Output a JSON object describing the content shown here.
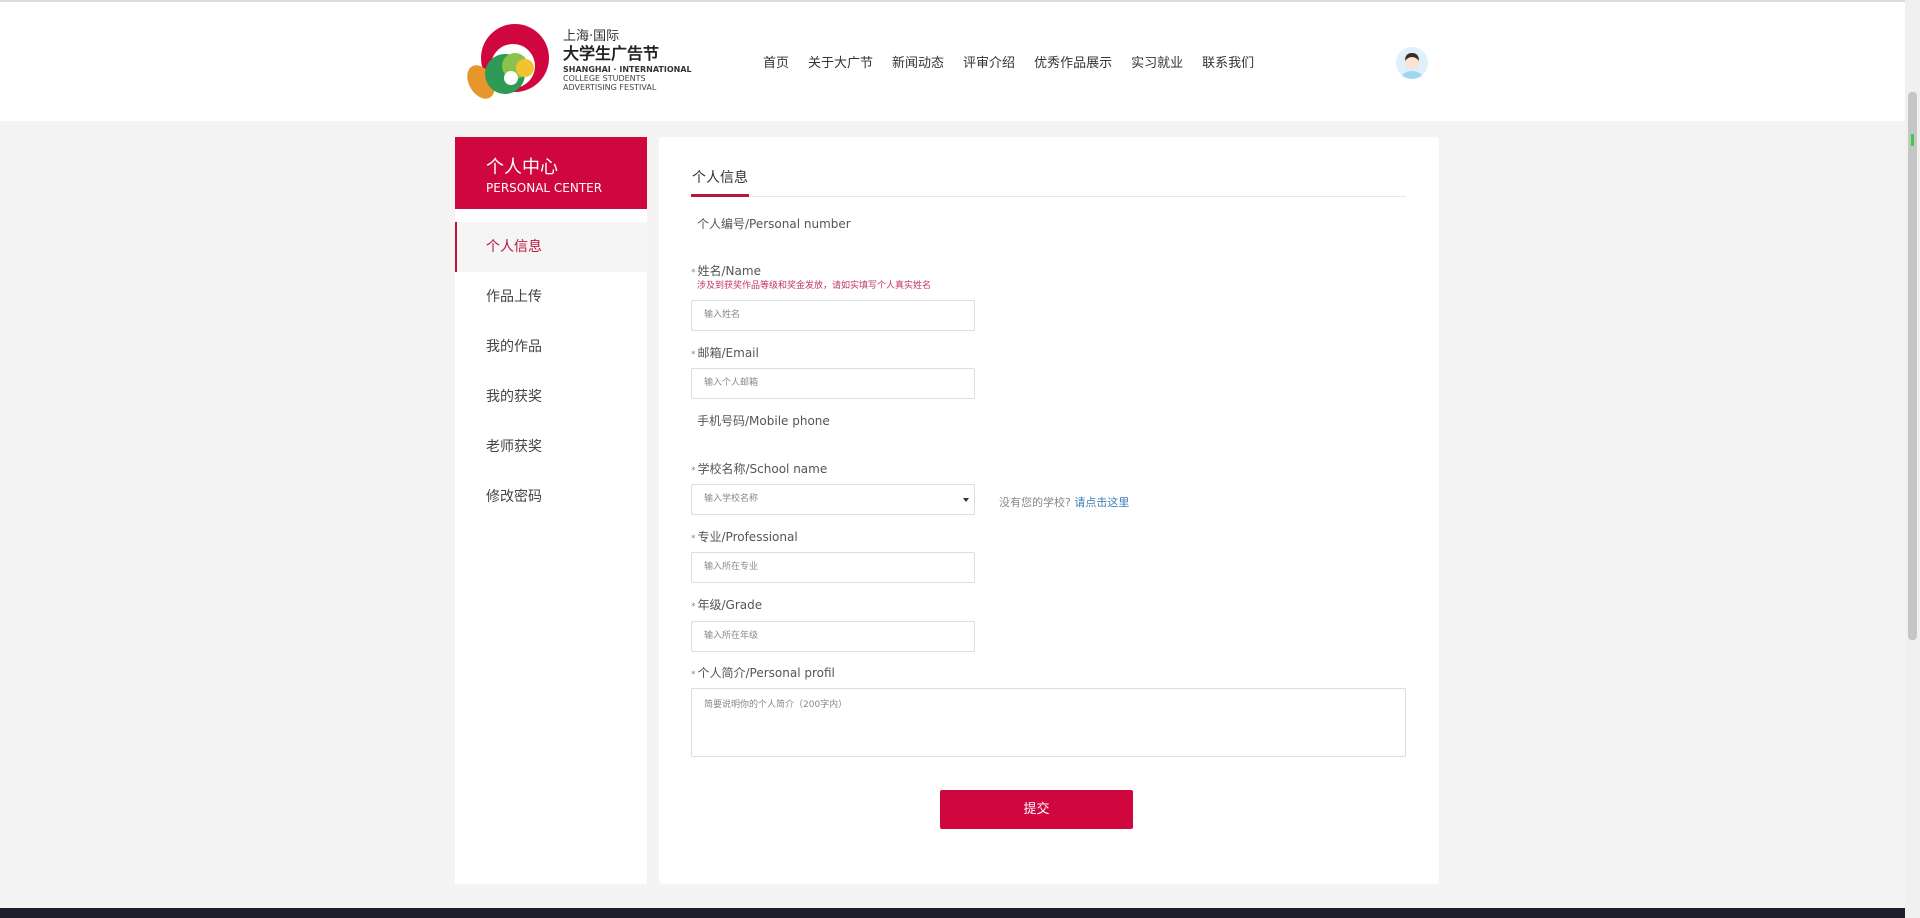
{
  "logo": {
    "line1": "上海·国际",
    "line2": "大学生广告节",
    "line3": "SHANGHAI · INTERNATIONAL",
    "line4": "COLLEGE STUDENTS",
    "line5": "ADVERTISING FESTIVAL"
  },
  "nav": [
    "首页",
    "关于大广节",
    "新闻动态",
    "评审介绍",
    "优秀作品展示",
    "实习就业",
    "联系我们"
  ],
  "sidebar": {
    "title": "个人中心",
    "subtitle": "PERSONAL CENTER",
    "items": [
      "个人信息",
      "作品上传",
      "我的作品",
      "我的获奖",
      "老师获奖",
      "修改密码"
    ]
  },
  "main": {
    "tab": "个人信息",
    "personal_number": "个人编号/Personal number",
    "name_label": "姓名/Name",
    "name_hint": "涉及到获奖作品等级和奖金发放，请如实填写个人真实姓名",
    "name_placeholder": "输入姓名",
    "email_label": "邮箱/Email",
    "email_placeholder": "输入个人邮箱",
    "mobile_label": "手机号码/Mobile phone",
    "school_label": "学校名称/School name",
    "school_placeholder": "输入学校名称",
    "no_school": "没有您的学校?",
    "no_school_link": "请点击这里",
    "major_label": "专业/Professional",
    "major_placeholder": "输入所在专业",
    "grade_label": "年级/Grade",
    "grade_placeholder": "输入所在年级",
    "profile_label": "个人简介/Personal profil",
    "profile_placeholder": "简要说明你的个人简介（200字内）",
    "submit": "提交",
    "required_mark": "*"
  },
  "colors": {
    "brand": "#d0073f",
    "link": "#3c7fb8"
  }
}
